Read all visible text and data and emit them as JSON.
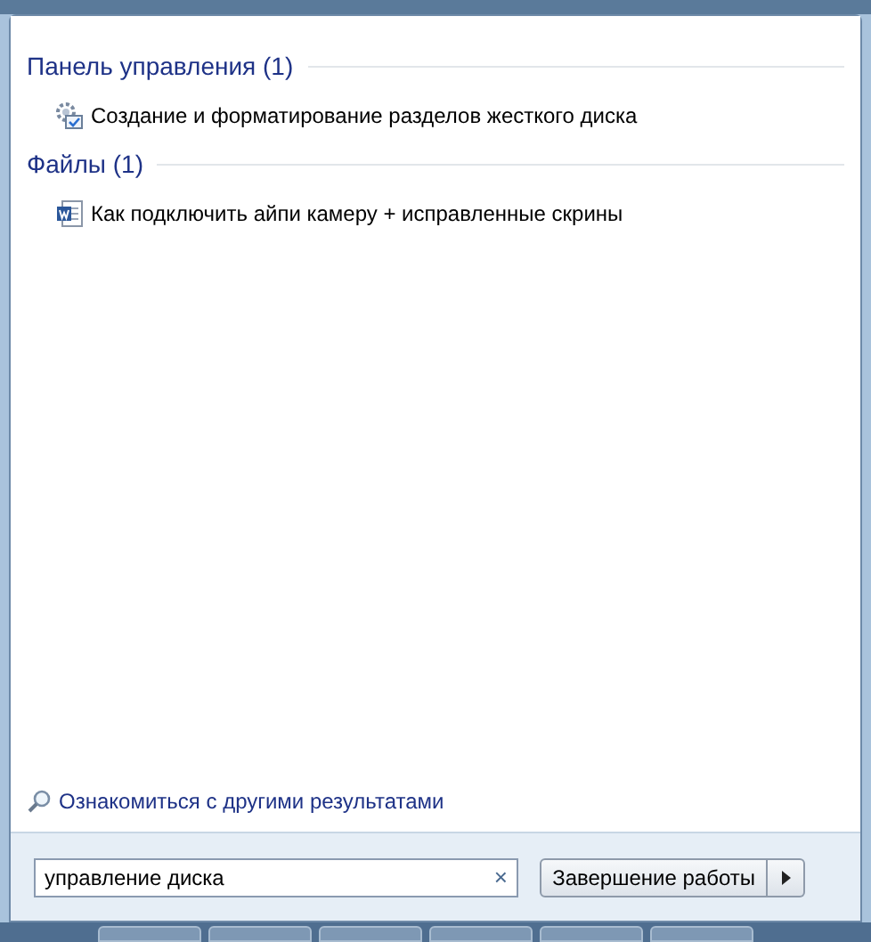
{
  "groups": [
    {
      "heading": "Панель управления (1)",
      "kind": "settings",
      "items": [
        "Создание и форматирование разделов жесткого диска"
      ]
    },
    {
      "heading": "Файлы (1)",
      "kind": "document",
      "items": [
        "Как подключить айпи камеру + исправленные скрины"
      ]
    }
  ],
  "more_results": "Ознакомиться с другими результатами",
  "search": {
    "value": "управление диска",
    "clear": "×"
  },
  "shutdown": {
    "label": "Завершение работы"
  }
}
